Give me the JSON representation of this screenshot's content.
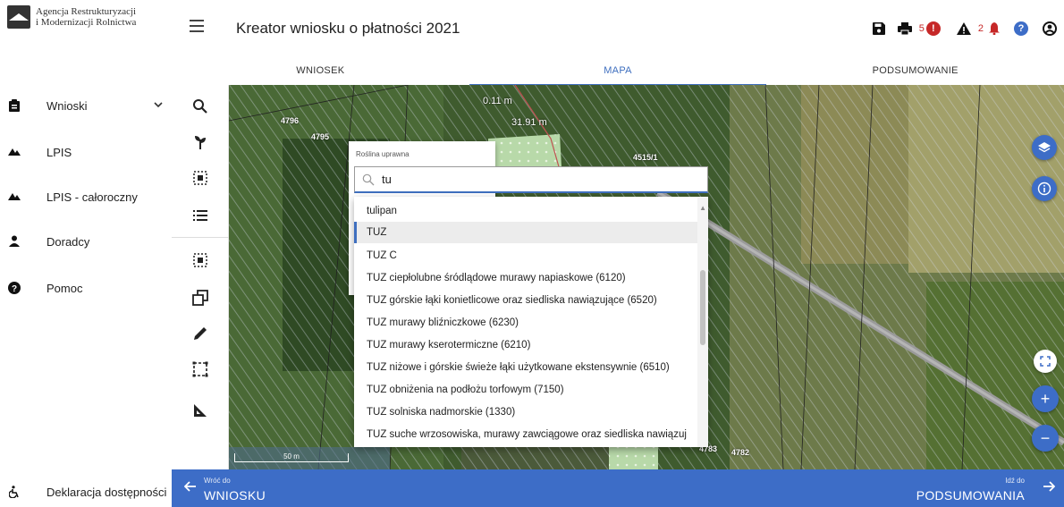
{
  "logo": {
    "line1": "Agencja Restrukturyzacji",
    "line2": "i Modernizacji Rolnictwa",
    "icon": "arimr-logo"
  },
  "header": {
    "title": "Kreator wniosku o płatności 2021",
    "icons": [
      "menu-icon",
      "save-icon",
      "print-icon",
      "error-icon",
      "warning-icon",
      "notification-bell-icon",
      "help-icon",
      "account-icon"
    ],
    "error_count": "5",
    "warning_count": "2",
    "error_color": "#c62828",
    "help_color": "#3d6dc7"
  },
  "tabs": [
    {
      "label": "WNIOSEK",
      "active": false
    },
    {
      "label": "MAPA",
      "active": true
    },
    {
      "label": "PODSUMOWANIE",
      "active": false
    }
  ],
  "sidebar": {
    "items": [
      {
        "label": "Wnioski",
        "icon": "clipboard-icon",
        "expandable": true
      },
      {
        "label": "LPIS",
        "icon": "terrain-icon"
      },
      {
        "label": "LPIS - całoroczny",
        "icon": "terrain-icon"
      },
      {
        "label": "Doradcy",
        "icon": "person-icon"
      },
      {
        "label": "Pomoc",
        "icon": "help-icon"
      }
    ],
    "footer": {
      "label": "Deklaracja dostępności",
      "icon": "accessibility-icon"
    }
  },
  "toolbar": {
    "tools": [
      "search-icon",
      "plant-icon",
      "select-area-icon",
      "list-icon",
      "select-area-icon",
      "copy-geometry-icon",
      "pencil-icon",
      "frame-select-icon",
      "measure-angle-icon"
    ]
  },
  "map": {
    "parcel_labels": [
      "4796",
      "4795",
      "4515/1",
      "4783",
      "4782"
    ],
    "measurements": [
      "0.11 m",
      "31.91 m"
    ],
    "scale_label": "50 m",
    "controls": [
      "layers-icon",
      "info-icon",
      "fullscreen-icon",
      "zoom-in-icon",
      "zoom-out-icon"
    ]
  },
  "crop_dialog": {
    "label": "Roślina uprawna",
    "search_value": "tu",
    "options": [
      "tulipan",
      "TUZ",
      "TUZ C",
      "TUZ ciepłolubne śródlądowe murawy napiaskowe (6120)",
      "TUZ górskie łąki konietlicowe oraz siedliska nawiązujące (6520)",
      "TUZ murawy bliźniczkowe (6230)",
      "TUZ murawy kserotermiczne (6210)",
      "TUZ niżowe i górskie świeże łąki użytkowane ekstensywnie (6510)",
      "TUZ obniżenia na podłożu torfowym (7150)",
      "TUZ solniska nadmorskie (1330)",
      "TUZ suche wrzosowiska, murawy zawciągowe oraz siedliska nawiązuj"
    ],
    "selected_index": 1
  },
  "footer_nav": {
    "back_small": "Wróć do",
    "back_big": "WNIOSKU",
    "next_small": "Idź do",
    "next_big": "PODSUMOWANIA",
    "color": "#3d6dc7"
  }
}
